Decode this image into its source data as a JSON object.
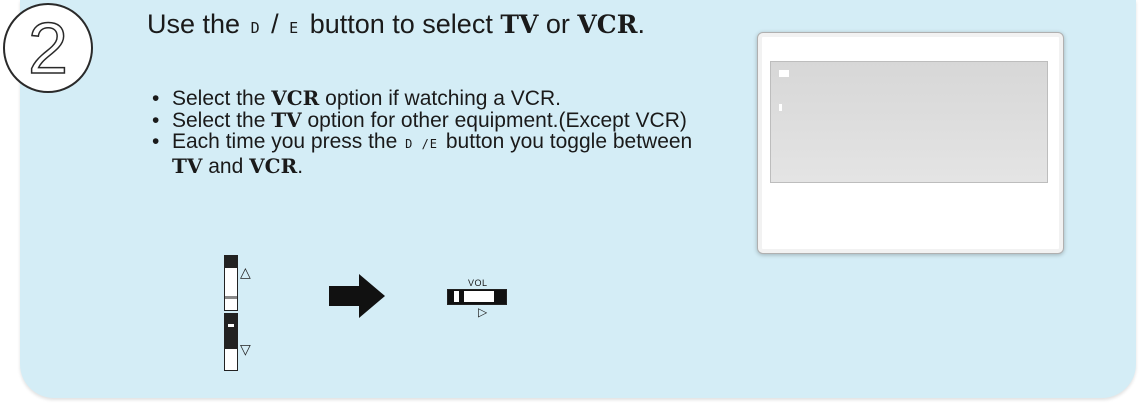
{
  "step": {
    "number": "2"
  },
  "heading": {
    "pre": "Use the",
    "sym_down": "D",
    "slash": "/",
    "sym_up": "E",
    "mid": "button to select",
    "tv": "TV",
    "or": "or",
    "vcr": "VCR",
    "period": "."
  },
  "bullets": [
    {
      "pre": "Select the",
      "kw": "VCR",
      "post": "option if watching a VCR."
    },
    {
      "pre": "Select the",
      "kw": "TV",
      "post": "option for other equipment.(Except VCR)"
    },
    {
      "pre": "Each time you press the",
      "sym": "D /E",
      "mid": "button you toggle between",
      "kw1": "TV",
      "and": "and",
      "kw2": "VCR",
      "end": "."
    }
  ],
  "illustration": {
    "vol_label": "VOL",
    "up_glyph": "△",
    "down_glyph": "▽",
    "right_glyph": "▷"
  }
}
